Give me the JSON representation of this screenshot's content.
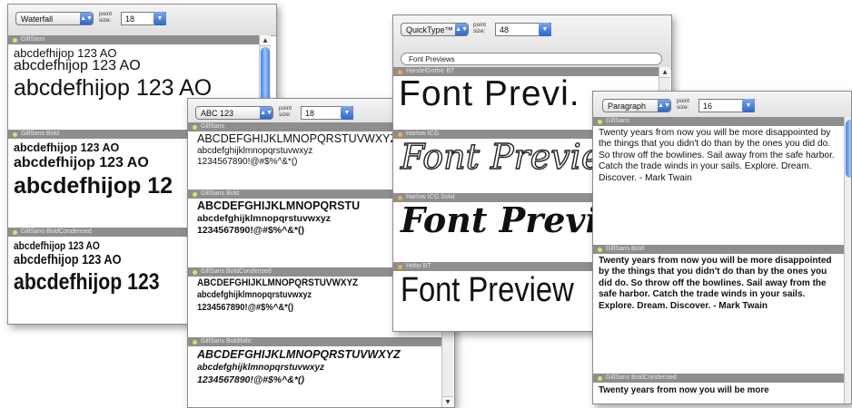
{
  "colors": {
    "header_bg": "#8e8e8e",
    "accent_blue": "#3f82ea",
    "dot_green": "#d7e36a",
    "dot_orange": "#f0b23a"
  },
  "panel1": {
    "mode": "Waterfall",
    "point_label": "point size:",
    "size": "18",
    "sections": [
      {
        "header": "GillSans",
        "lines": [
          "abcdefhijop 123 AO",
          "abcdefhijop 123 AO",
          "abcdefhijop 123 AO"
        ]
      },
      {
        "header": "GillSans Bold",
        "lines": [
          "abcdefhijop 123 AO",
          "abcdefhijop 123 AO",
          "abcdefhijop 12"
        ]
      },
      {
        "header": "GillSans BoldCondensed",
        "lines": [
          "abcdefhijop 123 AO",
          "abcdefhijop 123 AO",
          "abcdefhijop 123"
        ]
      }
    ]
  },
  "panel2": {
    "mode": "ABC 123",
    "point_label": "point size:",
    "size": "18",
    "sections": [
      {
        "header": "GillSans",
        "lines": [
          "ABCDEFGHIJKLMNOPQRSTUVWXYZ",
          "abcdefghijklmnopqrstuvwxyz",
          "1234567890!@#$%^&*()"
        ]
      },
      {
        "header": "GillSans Bold",
        "lines": [
          "ABCDEFGHIJKLMNOPQRSTU",
          "abcdefghijklmnopqrstuvwxyz",
          "1234567890!@#$%^&*()"
        ]
      },
      {
        "header": "GillSans BoldCondensed",
        "lines": [
          "ABCDEFGHIJKLMNOPQRSTUVWXYZ",
          "abcdefghijklmnopqrstuvwxyz",
          "1234567890!@#$%^&*()"
        ]
      },
      {
        "header": "GillSans BoldItalic",
        "lines": [
          "ABCDEFGHIJKLMNOPQRSTUVWXYZ",
          "abcdefghijklmnopqrstuvwxyz",
          "1234567890!@#$%^&*()"
        ]
      }
    ]
  },
  "panel3": {
    "mode": "QuickType™",
    "point_label": "point size:",
    "size": "48",
    "preview_text": "Font Previews",
    "sections": [
      {
        "header": "HandelGothic BT",
        "sample": "Font Previ."
      },
      {
        "header": "Harlow ICG",
        "sample": "Font Previews"
      },
      {
        "header": "Harlow ICG Solid",
        "sample": "Font Previews"
      },
      {
        "header": "Hobo BT",
        "sample": "Font Preview"
      }
    ]
  },
  "panel4": {
    "mode": "Paragraph",
    "point_label": "point size:",
    "size": "16",
    "sections": [
      {
        "header": "GillSans",
        "text": "Twenty years from now you will be more disappointed by the things that you didn't do than by the ones you did do. So throw off the bowlines. Sail away from the safe harbor. Catch the trade winds in your sails. Explore. Dream. Discover. - Mark Twain"
      },
      {
        "header": "GillSans Bold",
        "text": "Twenty years from now you will be more disappointed by the things that you didn't do than by the ones you did do. So throw off the bowlines. Sail away from the safe harbor. Catch the trade winds in your sails. Explore. Dream. Discover. - Mark Twain"
      },
      {
        "header": "GillSans BoldCondensed",
        "text": "Twenty years from now you will be more"
      }
    ]
  }
}
